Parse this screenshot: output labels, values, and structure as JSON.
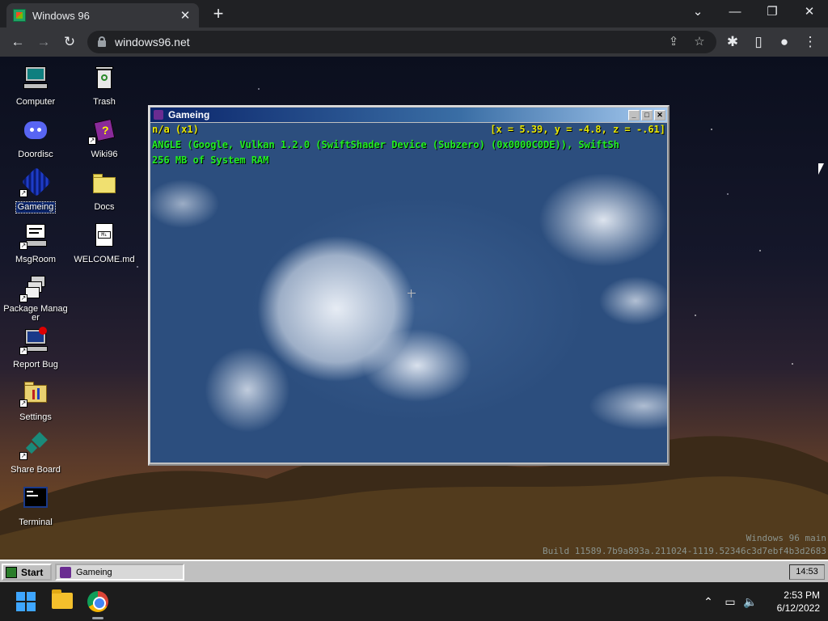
{
  "browser": {
    "tab_title": "Windows 96",
    "url": "windows96.net",
    "tab_close_glyph": "✕",
    "new_tab_glyph": "+",
    "window_controls": {
      "tabs_menu": "⌄",
      "minimize": "—",
      "restore": "❐",
      "close": "✕"
    },
    "nav": {
      "back": "←",
      "forward": "→",
      "reload": "↻"
    },
    "omnibox_icons": {
      "share": "⇪",
      "bookmark": "☆"
    },
    "toolbar_icons": {
      "extensions": "✱",
      "side_panel": "▯",
      "profile": "●",
      "menu": "⋮"
    }
  },
  "desktop": {
    "icons_left": [
      {
        "label": "Computer",
        "icon": "computer-icon"
      },
      {
        "label": "Doordisc",
        "icon": "doordisc-icon"
      },
      {
        "label": "Gameing",
        "icon": "gameing-icon",
        "selected": true
      },
      {
        "label": "MsgRoom",
        "icon": "msgroom-icon"
      },
      {
        "label": "Package Manager",
        "icon": "package-manager-icon"
      },
      {
        "label": "Report Bug",
        "icon": "report-bug-icon"
      },
      {
        "label": "Settings",
        "icon": "settings-icon"
      },
      {
        "label": "Share Board",
        "icon": "share-board-icon"
      },
      {
        "label": "Terminal",
        "icon": "terminal-icon"
      }
    ],
    "icons_right": [
      {
        "label": "Trash",
        "icon": "trash-icon"
      },
      {
        "label": "Wiki96",
        "icon": "wiki96-icon"
      },
      {
        "label": "Docs",
        "icon": "folder-icon"
      },
      {
        "label": "WELCOME.md",
        "icon": "markdown-file-icon"
      }
    ],
    "watermark_line1": "Windows 96 main",
    "watermark_line2": "Build 11589.7b9a893a.211024-1119.52346c3d7ebf4b3d2683"
  },
  "game_window": {
    "title": "Gameing",
    "buttons": {
      "minimize": "_",
      "maximize": "□",
      "close": "✕"
    },
    "hud_fps": "n/a (x1)",
    "hud_coords": "[x = 5.39, y = -4.8, z = -.61]",
    "hud_renderer": "ANGLE (Google, Vulkan 1.2.0 (SwiftShader Device (Subzero) (0x0000C0DE)), SwiftSh",
    "hud_memory": "256 MB of System RAM"
  },
  "w96_taskbar": {
    "start_label": "Start",
    "task_label": "Gameing",
    "time": "14:53"
  },
  "windows_taskbar": {
    "time": "2:53 PM",
    "date": "6/12/2022",
    "tray_icons": {
      "chevron": "⌃",
      "network": "▭",
      "volume": "🔈"
    }
  },
  "colors": {
    "chrome_dark": "#202124",
    "chrome_tab": "#35363a",
    "win_title_start": "#0a246a",
    "hud_yellow": "#e8e800",
    "hud_green": "#22ee22",
    "w96_face": "#c0c0c0"
  }
}
